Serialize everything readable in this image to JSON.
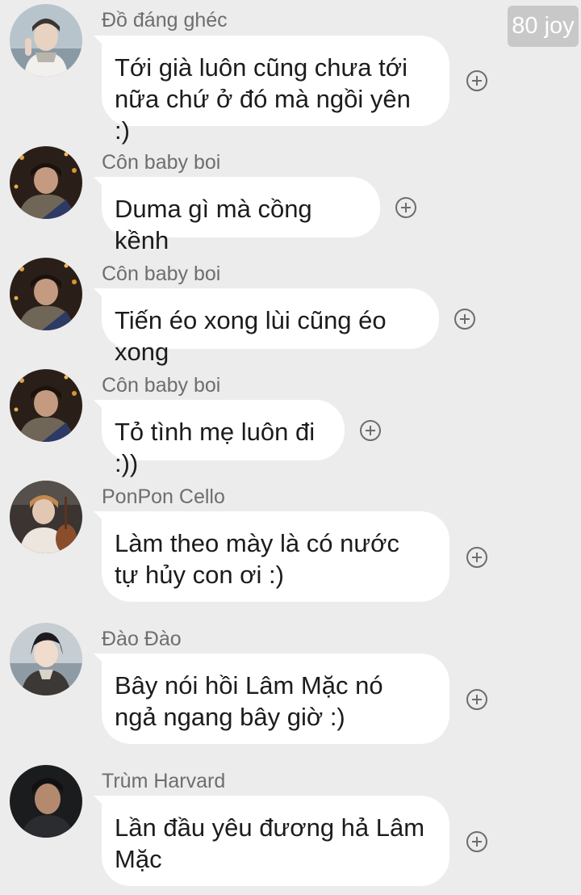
{
  "badge": {
    "text": "80 joy"
  },
  "messages": [
    {
      "sender": "Đồ đáng ghéc",
      "text": "Tới già luôn cũng chưa tới nữa chứ ở đó mà ngồi yên :)",
      "avatar": "avatar-boy-scarf"
    },
    {
      "sender": "Côn baby boi",
      "text": "Duma gì mà cồng kềnh",
      "avatar": "avatar-boy-lights"
    },
    {
      "sender": "Côn baby boi",
      "text": "Tiến éo xong lùi cũng éo xong",
      "avatar": "avatar-boy-lights"
    },
    {
      "sender": "Côn baby boi",
      "text": "Tỏ tình mẹ luôn đi :))",
      "avatar": "avatar-boy-lights"
    },
    {
      "sender": "PonPon Cello",
      "text": "Làm theo mày là có nước tự hủy con ơi :)",
      "avatar": "avatar-boy-cello"
    },
    {
      "sender": "Đào Đào",
      "text": "Bây nói hồi Lâm Mặc nó ngả ngang bây giờ :)",
      "avatar": "avatar-boy-sea"
    },
    {
      "sender": "Trùm Harvard",
      "text": "Lần đầu yêu đương hả Lâm Mặc",
      "avatar": "avatar-boy-dark"
    }
  ]
}
